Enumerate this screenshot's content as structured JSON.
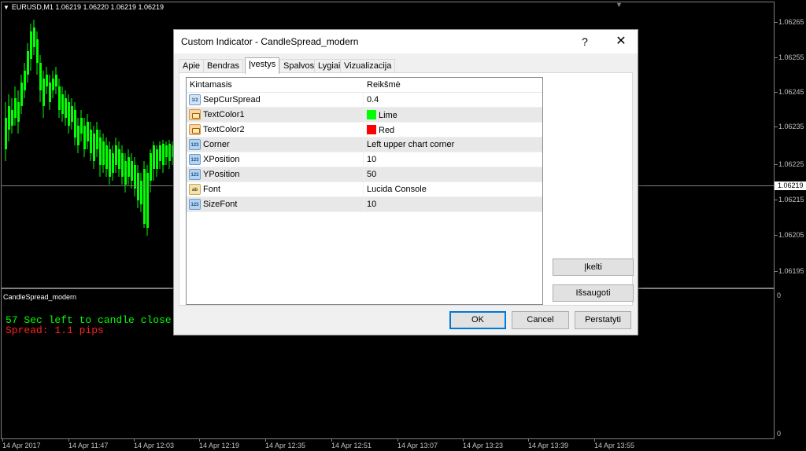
{
  "chart": {
    "symbol_info": "EURUSD,M1  1.06219 1.06220 1.06219 1.06219",
    "price_labels": [
      "1.06265",
      "1.06255",
      "1.06245",
      "1.06235",
      "1.06225",
      "1.06215",
      "1.06205",
      "1.06195"
    ],
    "current_price": "1.06219",
    "subwindow_title": "CandleSpread_modern",
    "subwindow_scale_top": "0",
    "subwindow_scale_bottom": "0",
    "overlay_line1": "57 Sec left to candle close",
    "overlay_line2": "Spread: 1.1 pips",
    "time_labels": [
      "14 Apr 2017",
      "14 Apr 11:47",
      "14 Apr 12:03",
      "14 Apr 12:19",
      "14 Apr 12:35",
      "14 Apr 12:51",
      "14 Apr 13:07",
      "14 Apr 13:23",
      "14 Apr 13:39",
      "14 Apr 13:55"
    ],
    "candle_color": "#00ff00",
    "grid_color": "#808080",
    "overlay_colors": {
      "line1": "#00ff00",
      "line2": "#ff2020"
    }
  },
  "dialog": {
    "title": "Custom Indicator - CandleSpread_modern",
    "help": "?",
    "close": "✕",
    "tabs": [
      "Apie",
      "Bendras",
      "Įvestys",
      "Spalvos",
      "Lygiai",
      "Vizualizacija"
    ],
    "active_tab": "Įvestys",
    "table": {
      "headers": [
        "Kintamasis",
        "Reikšmė"
      ],
      "rows": [
        {
          "icon": "double-icon",
          "icon_text": "1/2",
          "name": "SepCurSpread",
          "value": "0.4"
        },
        {
          "icon": "color-icon",
          "icon_text": "",
          "name": "TextColor1",
          "value": "Lime",
          "swatch": "#00ff00"
        },
        {
          "icon": "color-icon",
          "icon_text": "",
          "name": "TextColor2",
          "value": "Red",
          "swatch": "#ff0000"
        },
        {
          "icon": "integer-icon",
          "icon_text": "123",
          "name": "Corner",
          "value": "Left upper chart corner"
        },
        {
          "icon": "integer-icon",
          "icon_text": "123",
          "name": "XPosition",
          "value": "10"
        },
        {
          "icon": "integer-icon",
          "icon_text": "123",
          "name": "YPosition",
          "value": "50"
        },
        {
          "icon": "string-icon",
          "icon_text": "ab",
          "name": "Font",
          "value": "Lucida Console"
        },
        {
          "icon": "integer-icon",
          "icon_text": "123",
          "name": "SizeFont",
          "value": "10"
        }
      ]
    },
    "buttons": {
      "load": "Įkelti",
      "save": "Išsaugoti",
      "ok": "OK",
      "cancel": "Cancel",
      "reset": "Perstatyti"
    }
  }
}
